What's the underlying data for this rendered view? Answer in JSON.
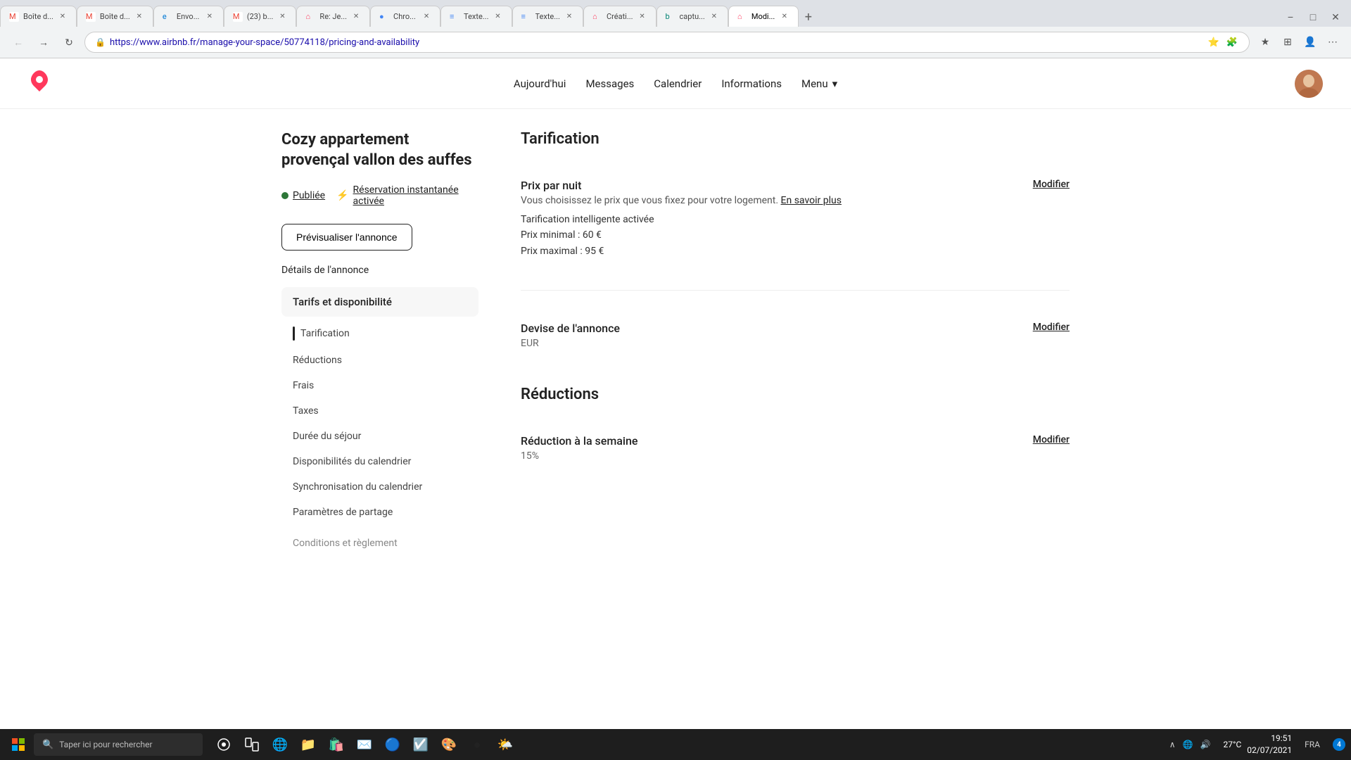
{
  "browser": {
    "tabs": [
      {
        "id": "t1",
        "label": "Boîte d...",
        "fav": "gmail",
        "active": false
      },
      {
        "id": "t2",
        "label": "Boîte d...",
        "fav": "gmail",
        "active": false
      },
      {
        "id": "t3",
        "label": "Envo...",
        "fav": "edge",
        "active": false
      },
      {
        "id": "t4",
        "label": "(23) b...",
        "fav": "gmail",
        "active": false
      },
      {
        "id": "t5",
        "label": "Re: Je...",
        "fav": "airbnb",
        "active": false
      },
      {
        "id": "t6",
        "label": "Chro...",
        "fav": "chrome",
        "active": false
      },
      {
        "id": "t7",
        "label": "Texte...",
        "fav": "docs",
        "active": false
      },
      {
        "id": "t8",
        "label": "Texte...",
        "fav": "docs",
        "active": false
      },
      {
        "id": "t9",
        "label": "Créati...",
        "fav": "airbnb",
        "active": false
      },
      {
        "id": "t10",
        "label": "captu...",
        "fav": "bing",
        "active": false
      },
      {
        "id": "t11",
        "label": "Modi...",
        "fav": "airbnb",
        "active": true
      }
    ],
    "url": "https://www.airbnb.fr/manage-your-space/50774118/pricing-and-availability"
  },
  "nav": {
    "today_label": "Aujourd'hui",
    "messages_label": "Messages",
    "calendar_label": "Calendrier",
    "informations_label": "Informations",
    "menu_label": "Menu"
  },
  "listing": {
    "title": "Cozy appartement provençal vallon des auffes",
    "status_label": "Publiée",
    "instant_label": "Réservation instantanée activée",
    "preview_btn": "Prévisualiser l'annonce"
  },
  "sidebar": {
    "details_label": "Détails de l'annonce",
    "tarifs_label": "Tarifs et disponibilité",
    "items": [
      {
        "label": "Tarification",
        "active": true,
        "indicator": true
      },
      {
        "label": "Réductions",
        "active": false,
        "indicator": false
      },
      {
        "label": "Frais",
        "active": false,
        "indicator": false
      },
      {
        "label": "Taxes",
        "active": false,
        "indicator": false
      },
      {
        "label": "Durée du séjour",
        "active": false,
        "indicator": false
      },
      {
        "label": "Disponibilités du calendrier",
        "active": false,
        "indicator": false
      },
      {
        "label": "Synchronisation du calendrier",
        "active": false,
        "indicator": false
      },
      {
        "label": "Paramètres de partage",
        "active": false,
        "indicator": false
      }
    ],
    "conditions_label": "Conditions et règlement"
  },
  "main": {
    "section_tarification": "Tarification",
    "prix_nuit_label": "Prix par nuit",
    "prix_nuit_desc": "Vous choisissez le prix que vous fixez pour votre logement.",
    "en_savoir_plus": "En savoir plus",
    "tarification_intelligente": "Tarification intelligente activée",
    "prix_minimal": "Prix minimal : 60 €",
    "prix_maximal": "Prix maximal : 95 €",
    "modify_prix": "Modifier",
    "devise_label": "Devise de l'annonce",
    "devise_value": "EUR",
    "modify_devise": "Modifier",
    "section_reductions": "Réductions",
    "reduction_semaine_label": "Réduction à la semaine",
    "reduction_semaine_value": "15%",
    "modify_reduction": "Modifier"
  },
  "taskbar": {
    "search_placeholder": "Taper ici pour rechercher",
    "weather": "27°C",
    "time": "19:51",
    "date": "02/07/2021",
    "lang": "FRA",
    "notif_count": "4"
  }
}
